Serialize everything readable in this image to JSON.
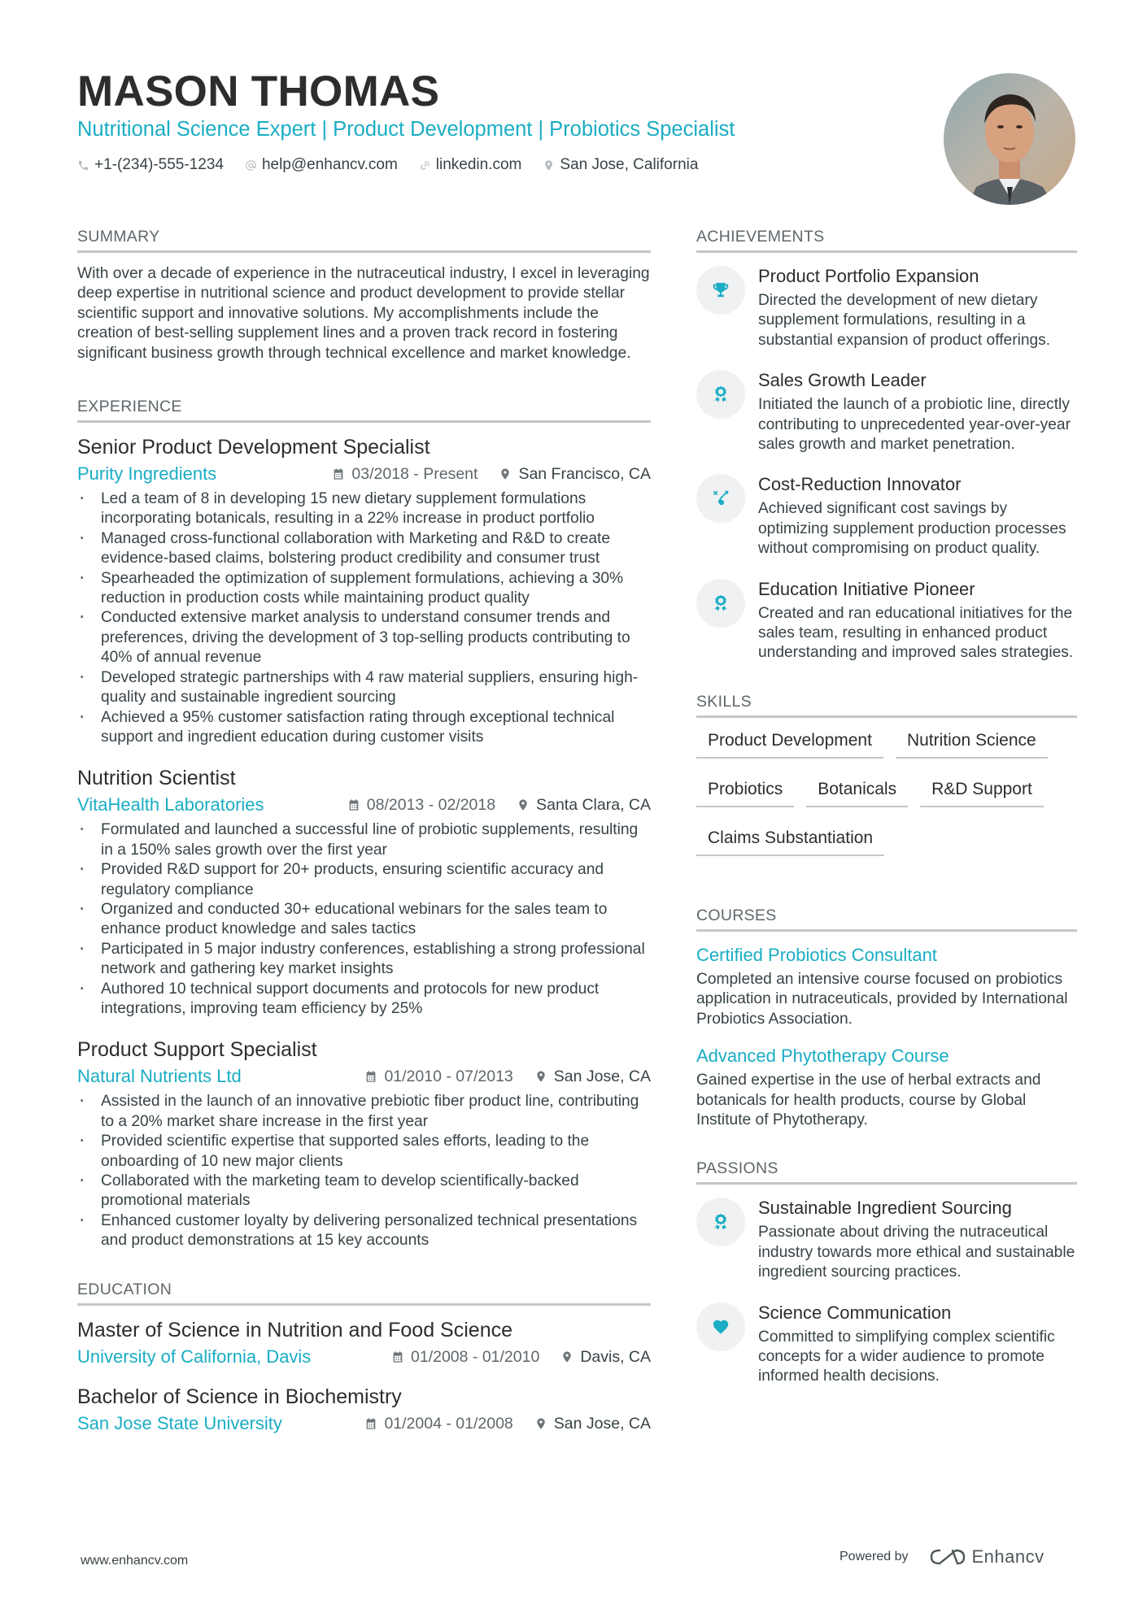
{
  "header": {
    "name": "MASON THOMAS",
    "subtitle": "Nutritional Science Expert | Product Development | Probiotics Specialist",
    "contacts": [
      {
        "icon": "phone-icon",
        "text": "+1-(234)-555-1234"
      },
      {
        "icon": "at-icon",
        "text": "help@enhancv.com"
      },
      {
        "icon": "link-icon",
        "text": "linkedin.com"
      },
      {
        "icon": "location-pin-icon",
        "text": "San Jose, California"
      }
    ]
  },
  "colors": {
    "accent": "#1aadc4",
    "text": "#384347",
    "heading": "#2d2d2d",
    "rule": "#c3c7ca",
    "icon_bg": "#f0f1f2"
  },
  "summary": {
    "title": "SUMMARY",
    "text": "With over a decade of experience in the nutraceutical industry, I excel in leveraging deep expertise in nutritional science and product development to provide stellar scientific support and innovative solutions. My accomplishments include the creation of best-selling supplement lines and a proven track record in fostering significant business growth through technical excellence and market knowledge."
  },
  "experience": {
    "title": "EXPERIENCE",
    "jobs": [
      {
        "title": "Senior Product Development Specialist",
        "company": "Purity Ingredients",
        "dates": "03/2018 - Present",
        "location": "San Francisco, CA",
        "bullets": [
          "Led a team of 8 in developing 15 new dietary supplement formulations incorporating botanicals, resulting in a 22% increase in product portfolio",
          "Managed cross-functional collaboration with Marketing and R&D to create evidence-based claims, bolstering product credibility and consumer trust",
          "Spearheaded the optimization of supplement formulations, achieving a 30% reduction in production costs while maintaining product quality",
          "Conducted extensive market analysis to understand consumer trends and preferences, driving the development of 3 top-selling products contributing to 40% of annual revenue",
          "Developed strategic partnerships with 4 raw material suppliers, ensuring high-quality and sustainable ingredient sourcing",
          "Achieved a 95% customer satisfaction rating through exceptional technical support and ingredient education during customer visits"
        ]
      },
      {
        "title": "Nutrition Scientist",
        "company": "VitaHealth Laboratories",
        "dates": "08/2013 - 02/2018",
        "location": "Santa Clara, CA",
        "bullets": [
          "Formulated and launched a successful line of probiotic supplements, resulting in a 150% sales growth over the first year",
          "Provided R&D support for 20+ products, ensuring scientific accuracy and regulatory compliance",
          "Organized and conducted 30+ educational webinars for the sales team to enhance product knowledge and sales tactics",
          "Participated in 5 major industry conferences, establishing a strong professional network and gathering key market insights",
          "Authored 10 technical support documents and protocols for new product integrations, improving team efficiency by 25%"
        ]
      },
      {
        "title": "Product Support Specialist",
        "company": "Natural Nutrients Ltd",
        "dates": "01/2010 - 07/2013",
        "location": "San Jose, CA",
        "bullets": [
          "Assisted in the launch of an innovative prebiotic fiber product line, contributing to a 20% market share increase in the first year",
          "Provided scientific expertise that supported sales efforts, leading to the onboarding of 10 new major clients",
          "Collaborated with the marketing team to develop scientifically-backed promotional materials",
          "Enhanced customer loyalty by delivering personalized technical presentations and product demonstrations at 15 key accounts"
        ]
      }
    ]
  },
  "education": {
    "title": "EDUCATION",
    "items": [
      {
        "degree": "Master of Science in Nutrition and Food Science",
        "school": "University of California, Davis",
        "dates": "01/2008 - 01/2010",
        "location": "Davis, CA"
      },
      {
        "degree": "Bachelor of Science in Biochemistry",
        "school": "San Jose State University",
        "dates": "01/2004 - 01/2008",
        "location": "San Jose, CA"
      }
    ]
  },
  "achievements": {
    "title": "ACHIEVEMENTS",
    "items": [
      {
        "icon": "trophy-icon",
        "title": "Product Portfolio Expansion",
        "desc": "Directed the development of new dietary supplement formulations, resulting in a substantial expansion of product offerings."
      },
      {
        "icon": "award-ribbon-icon",
        "title": "Sales Growth Leader",
        "desc": "Initiated the launch of a probiotic line, directly contributing to unprecedented year-over-year sales growth and market penetration."
      },
      {
        "icon": "strategy-arrow-icon",
        "title": "Cost-Reduction Innovator",
        "desc": "Achieved significant cost savings by optimizing supplement production processes without compromising on product quality."
      },
      {
        "icon": "award-ribbon-icon",
        "title": "Education Initiative Pioneer",
        "desc": "Created and ran educational initiatives for the sales team, resulting in enhanced product understanding and improved sales strategies."
      }
    ]
  },
  "skills": {
    "title": "SKILLS",
    "items": [
      "Product Development",
      "Nutrition Science",
      "Probiotics",
      "Botanicals",
      "R&D Support",
      "Claims Substantiation"
    ]
  },
  "courses": {
    "title": "COURSES",
    "items": [
      {
        "title": "Certified Probiotics Consultant",
        "desc": "Completed an intensive course focused on probiotics application in nutraceuticals, provided by International Probiotics Association."
      },
      {
        "title": "Advanced Phytotherapy Course",
        "desc": "Gained expertise in the use of herbal extracts and botanicals for health products, course by Global Institute of Phytotherapy."
      }
    ]
  },
  "passions": {
    "title": "PASSIONS",
    "items": [
      {
        "icon": "award-ribbon-icon",
        "title": "Sustainable Ingredient Sourcing",
        "desc": "Passionate about driving the nutraceutical industry towards more ethical and sustainable ingredient sourcing practices."
      },
      {
        "icon": "heart-icon",
        "title": "Science Communication",
        "desc": "Committed to simplifying complex scientific concepts for a wider audience to promote informed health decisions."
      }
    ]
  },
  "footer": {
    "website": "www.enhancv.com",
    "powered_by": "Powered by",
    "brand": "Enhancv"
  }
}
